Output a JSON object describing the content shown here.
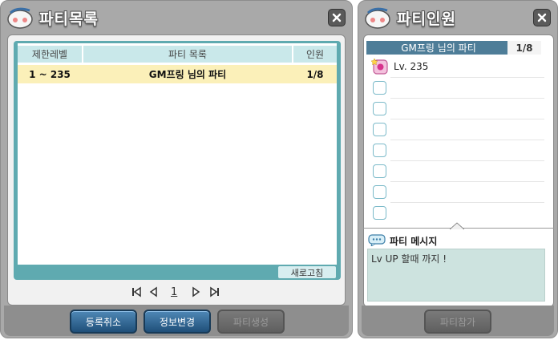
{
  "party_list_window": {
    "title": "파티목록",
    "columns": [
      "제한레벨",
      "파티 목록",
      "인원"
    ],
    "rows": [
      {
        "level_range": "1 ~ 235",
        "party_name": "GM프링 님의 파티",
        "members": "1/8"
      }
    ],
    "refresh_label": "새로고침",
    "current_page": "1",
    "buttons": {
      "cancel_registration": "등록취소",
      "edit_info": "정보변경",
      "create_party": "파티생성"
    }
  },
  "party_members_window": {
    "title": "파티인원",
    "party_name": "GM프링 님의 파티",
    "member_count": "1/8",
    "members": [
      {
        "label": "Lv. 235"
      }
    ],
    "message_title": "파티 메시지",
    "message_text": "Lv UP 할때 까지 !",
    "join_label": "파티참가"
  },
  "colors": {
    "window_bg": "#a9a9a9",
    "list_header": "#c9e8ea",
    "selected_row": "#fbf0b9",
    "accent_teal": "#5faab0",
    "button_blue": "#2f648f"
  }
}
